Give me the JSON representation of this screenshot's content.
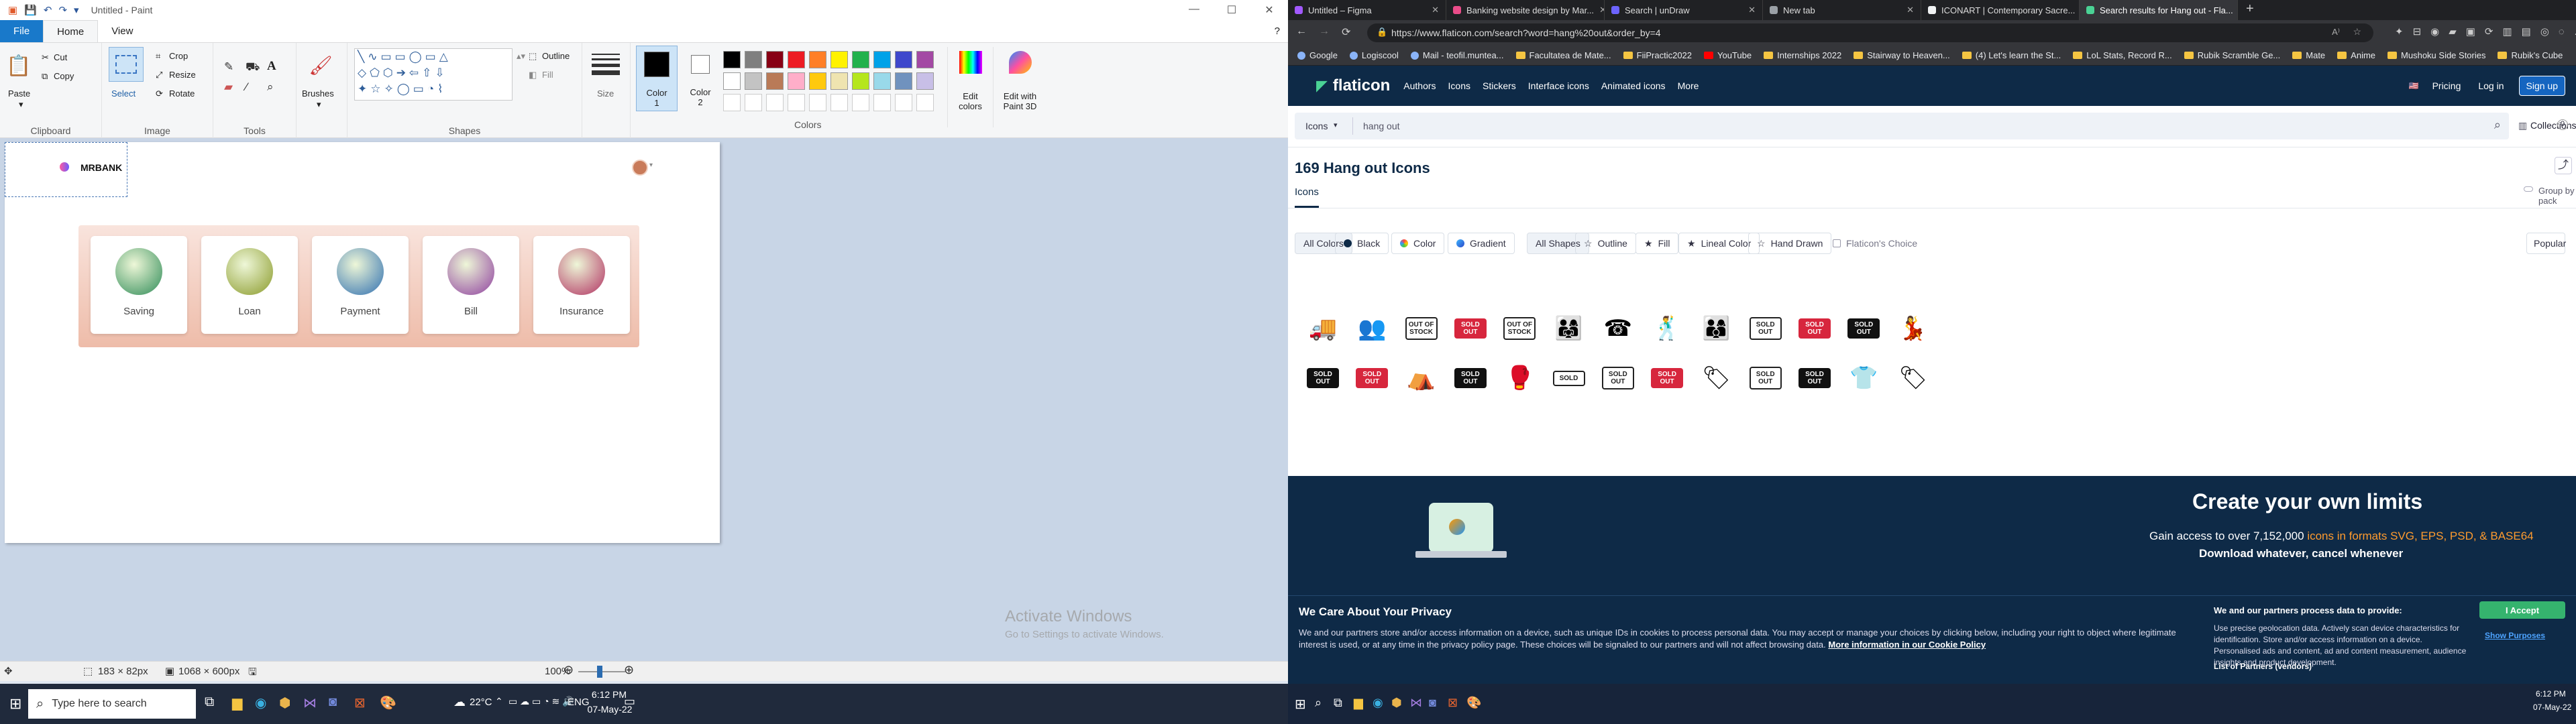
{
  "paint": {
    "window_title": "Untitled - Paint",
    "tabs": [
      "File",
      "Home",
      "View"
    ],
    "clipboard": {
      "paste": "Paste",
      "cut": "Cut",
      "copy": "Copy",
      "label": "Clipboard"
    },
    "image": {
      "select": "Select",
      "crop": "Crop",
      "resize": "Resize",
      "rotate": "Rotate",
      "label": "Image"
    },
    "tools_label": "Tools",
    "brushes": "Brushes",
    "shapes": {
      "outline": "Outline",
      "fill": "Fill",
      "label": "Shapes"
    },
    "size": "Size",
    "color1": "Color 1",
    "color2": "Color 2",
    "colors_label": "Colors",
    "edit_colors": "Edit colors",
    "edit_with_paint3d": "Edit with Paint 3D",
    "palette_row1": [
      "#000000",
      "#7f7f7f",
      "#880015",
      "#ed1c24",
      "#ff7f27",
      "#fff200",
      "#22b14c",
      "#00a2e8",
      "#3f48cc",
      "#a349a4"
    ],
    "palette_row2": [
      "#ffffff",
      "#c3c3c3",
      "#b97a57",
      "#ffaec9",
      "#ffc90e",
      "#efe4b0",
      "#b5e61d",
      "#99d9ea",
      "#7092be",
      "#c8bfe7"
    ],
    "canvas": {
      "brand": "MRBANK",
      "services": [
        {
          "label": "Saving",
          "color": "#2e8b57"
        },
        {
          "label": "Loan",
          "color": "#8a9a2a"
        },
        {
          "label": "Payment",
          "color": "#2f6fb0"
        },
        {
          "label": "Bill",
          "color": "#8e3f9e"
        },
        {
          "label": "Insurance",
          "color": "#b03060"
        }
      ]
    },
    "status": {
      "selection": "183 × 82px",
      "canvas_size": "1068 × 600px",
      "zoom": "100%"
    },
    "watermark_line1": "Activate Windows",
    "watermark_line2": "Go to Settings to activate Windows."
  },
  "taskbar_left": {
    "search_placeholder": "Type here to search",
    "weather": "22°C",
    "lang": "ENG",
    "time": "6:12 PM",
    "date": "07-May-22"
  },
  "taskbar_right": {
    "time": "6:12 PM",
    "date": "07-May-22"
  },
  "browser": {
    "tabs": [
      "Untitled – Figma",
      "Banking website design by Mar...",
      "Search | unDraw",
      "New tab",
      "ICONART | Contemporary Sacre...",
      "Search results for Hang out - Fla..."
    ],
    "url": "https://www.flaticon.com/search?word=hang%20out&order_by=4",
    "bookmarks": [
      "Google",
      "Logiscool",
      "Mail - teofil.muntea...",
      "Facultatea de Mate...",
      "FiiPractic2022",
      "YouTube",
      "Internships 2022",
      "Stairway to Heaven...",
      "(4) Let's learn the St...",
      "LoL Stats, Record R...",
      "Rubik Scramble Ge...",
      "Mate",
      "Anime",
      "Mushoku Side Stories",
      "Rubik's Cube"
    ]
  },
  "flaticon": {
    "logo": "flaticon",
    "nav": [
      "Authors",
      "Icons",
      "Stickers",
      "Interface icons",
      "Animated icons",
      "More"
    ],
    "nav_right": [
      "Pricing",
      "Log in",
      "Sign up"
    ],
    "search_type": "Icons",
    "search_value": "hang out",
    "collections": "Collections",
    "collections_count": "0",
    "results_title": "169 Hang out Icons",
    "subtab": "Icons",
    "group_by_pack": "Group by pack",
    "color_filters": [
      "All Colors",
      "Black",
      "Color",
      "Gradient"
    ],
    "shape_filters": [
      "All Shapes",
      "Outline",
      "Fill",
      "Lineal Color",
      "Hand Drawn"
    ],
    "choice": "Flaticon's Choice",
    "sort": "Popular",
    "row1_icons": [
      "food-truck-icon",
      "delivery-people-icon",
      "out-of-stock-stamp-icon",
      "sold-out-banner-icon",
      "out-of-stock-badge-icon",
      "group-gradient-icon",
      "hang-up-phone-icon",
      "two-people-icon",
      "three-people-icon",
      "sold-out-sign-icon",
      "sold-out-red-icon",
      "sold-out-hanging-icon",
      "hugging-people-icon"
    ],
    "row2_icons": [
      "sold-out-hanging-black-icon",
      "sold-out-red-banner-icon",
      "market-stall-icon",
      "sold-out-black-sign-icon",
      "fighting-people-icon",
      "sold-tag-icon",
      "sold-out-outline-icon",
      "sold-out-red-ribbon-icon",
      "price-tag-icon",
      "sold-out-sign-outline-icon",
      "sold-out-blue-icon",
      "hanging-shirt-icon",
      "sale-tag-blue-icon"
    ],
    "row1_texts": [
      "",
      "",
      "OUT OF STOCK",
      "SOLD OUT",
      "OUT OF STOCK",
      "",
      "",
      "",
      "",
      "SOLD OUT",
      "SOLD OUT",
      "SOLD OUT",
      ""
    ],
    "row2_texts": [
      "SOLD OUT",
      "SOLD OUT",
      "",
      "SOLD OUT",
      "",
      "SOLD",
      "SOLD OUT",
      "SOLD OUT",
      "",
      "SOLD OUT",
      "SOLD OUT",
      "",
      ""
    ],
    "promo": {
      "title": "Create your own limits",
      "line1_prefix": "Gain access to over 7,152,000 ",
      "line1_highlight": "icons in formats",
      "line1_formats": " SVG, EPS, PSD, & BASE64",
      "line2": "Download whatever, cancel whenever"
    },
    "cookie": {
      "title": "We Care About Your Privacy",
      "body": "We and our partners store and/or access information on a device, such as unique IDs in cookies to process personal data. You may accept or manage your choices by clicking below, including your right to object where legitimate interest is used, or at any time in the privacy policy page. These choices will be signaled to our partners and will not affect browsing data.",
      "more_info": "More information in our Cookie Policy",
      "partners_title": "We and our partners process data to provide:",
      "partners_body": "Use precise geolocation data. Actively scan device characteristics for identification. Store and/or access information on a device. Personalised ads and content, ad and content measurement, audience insights and product development.",
      "partners_list": "List of Partners (vendors)",
      "accept": "I Accept",
      "show_purposes": "Show Purposes"
    }
  }
}
